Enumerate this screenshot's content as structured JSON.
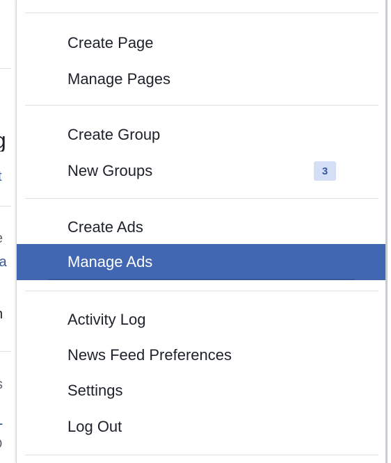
{
  "background_fragments": [
    {
      "text": "g",
      "style": "bold"
    },
    {
      "text": "st",
      "style": "link"
    },
    {
      "text": "e",
      "style": "muted"
    },
    {
      "text": "la",
      "style": "link"
    },
    {
      "text": "n",
      "style": "normal"
    },
    {
      "text": "s",
      "style": "muted"
    },
    {
      "text": "-",
      "style": "link"
    },
    {
      "text": "D",
      "style": "muted"
    }
  ],
  "menu": {
    "groups": [
      {
        "items": [
          {
            "label": "Create Page"
          },
          {
            "label": "Manage Pages"
          }
        ]
      },
      {
        "items": [
          {
            "label": "Create Group"
          },
          {
            "label": "New Groups",
            "badge": "3"
          }
        ]
      },
      {
        "items": [
          {
            "label": "Create Ads"
          },
          {
            "label": "Manage Ads",
            "active": true
          }
        ]
      },
      {
        "items": [
          {
            "label": "Activity Log"
          },
          {
            "label": "News Feed Preferences"
          },
          {
            "label": "Settings"
          },
          {
            "label": "Log Out"
          }
        ]
      }
    ]
  },
  "colors": {
    "active_bg": "#4267b2",
    "badge_bg": "#d4dff5",
    "badge_text": "#365899",
    "text": "#1d2129",
    "separator": "#dddfe2"
  }
}
